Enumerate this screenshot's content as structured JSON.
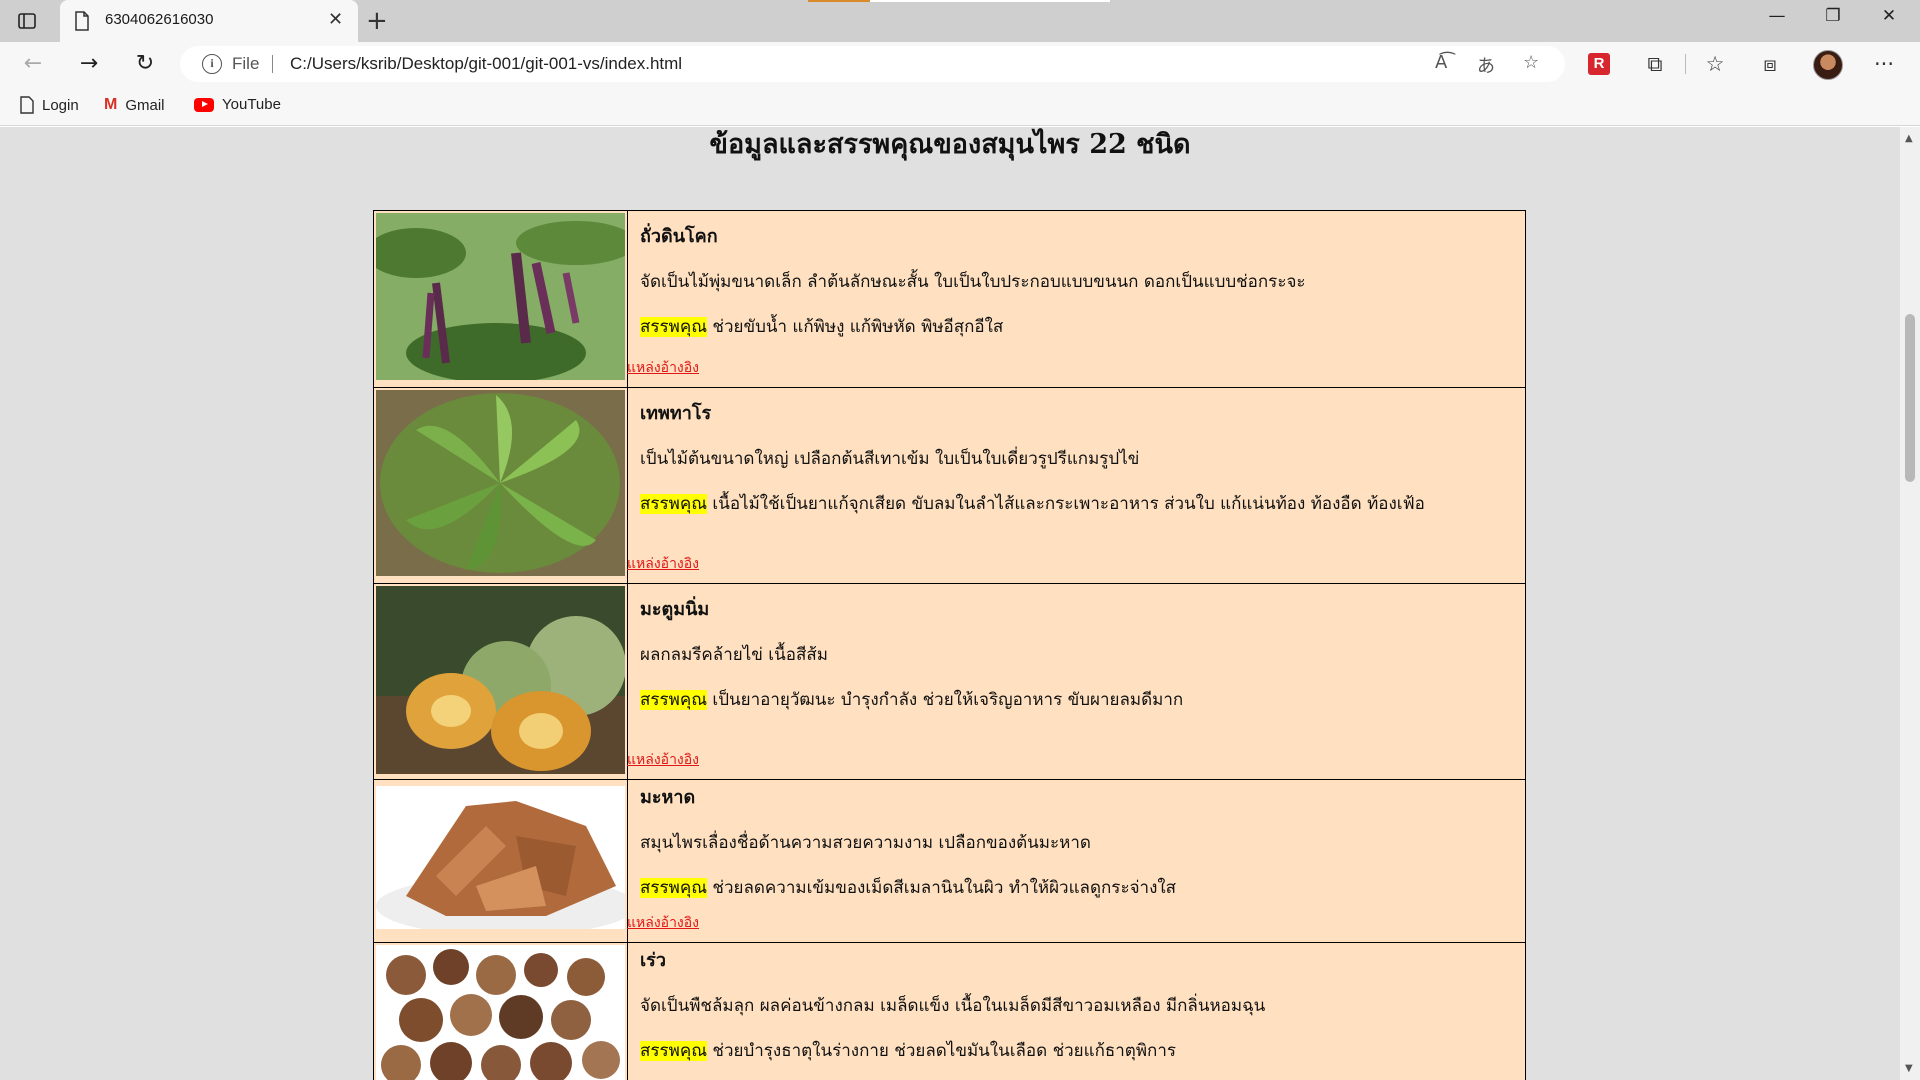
{
  "browser": {
    "tab_title": "6304062616030",
    "address_prefix": "File",
    "url": "C:/Users/ksrib/Desktop/git-001/git-001-vs/index.html",
    "bookmarks": [
      "Login",
      "Gmail",
      "YouTube"
    ],
    "icons": {
      "sidebar": "tab-actions-icon",
      "page": "page-icon",
      "close": "close-icon",
      "new_tab": "plus-icon",
      "back": "back-arrow-icon",
      "forward": "forward-arrow-icon",
      "reload": "reload-icon",
      "read_aloud": "read-aloud-icon",
      "translate": "translate-icon",
      "favorite_add": "star-plus-icon",
      "extension_r": "r-extension-icon",
      "extensions": "puzzle-icon",
      "favorites": "favorites-icon",
      "collections": "collections-icon",
      "profile": "avatar",
      "more": "more-icon"
    }
  },
  "page": {
    "title": "ข้อมูลและสรรพคุณของสมุนไพร 22 ชนิด",
    "benefit_label": "สรรพคุณ",
    "reference_label": "แหล่งอ้างอิง",
    "herbs": [
      {
        "name": "ถั่วดินโคก",
        "description": "จัดเป็นไม้พุ่มขนาดเล็ก ลำต้นลักษณะสั้น ใบเป็นใบประกอบแบบขนนก ดอกเป็นแบบช่อกระจะ",
        "benefit": "ช่วยขับน้ำ แก้พิษงู แก้พิษหัด พิษอีสุกอีใส"
      },
      {
        "name": "เทพทาโร",
        "description": "เป็นไม้ต้นขนาดใหญ่ เปลือกต้นสีเทาเข้ม ใบเป็นใบเดี่ยวรูปรีแกมรูปไข่",
        "benefit": "เนื้อไม้ใช้เป็นยาแก้จุกเสียด ขับลมในลำไส้และกระเพาะอาหาร ส่วนใบ แก้แน่นท้อง ท้องอืด ท้องเฟ้อ"
      },
      {
        "name": "มะตูมนิ่ม",
        "description": "ผลกลมรีคล้ายไข่ เนื้อสีส้ม",
        "benefit": "เป็นยาอายุวัฒนะ บำรุงกำลัง ช่วยให้เจริญอาหาร ขับผายลมดีมาก"
      },
      {
        "name": "มะหาด",
        "description": "สมุนไพรเลื่องชื่อด้านความสวยความงาม เปลือกของต้นมะหาด",
        "benefit": "ช่วยลดความเข้มของเม็ดสีเมลานินในผิว ทำให้ผิวแลดูกระจ่างใส"
      },
      {
        "name": "เร่ว",
        "description": "จัดเป็นพืชล้มลุก ผลค่อนข้างกลม เมล็ดแข็ง เนื้อในเมล็ดมีสีขาวอมเหลือง มีกลิ่นหอมฉุน",
        "benefit": "ช่วยบำรุงธาตุในร่างกาย ช่วยลดไขมันในเลือด ช่วยแก้ธาตุพิการ"
      }
    ]
  },
  "colors": {
    "page_bg": "#e0e0e0",
    "row_bg": "#ffe1c1",
    "highlight": "#ffff00",
    "link": "#e01818"
  }
}
